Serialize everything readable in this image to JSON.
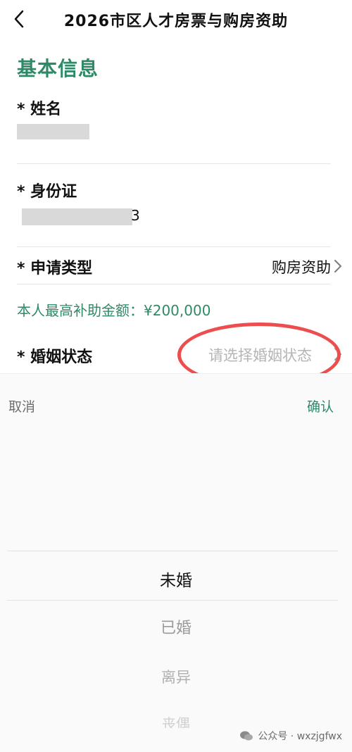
{
  "header": {
    "title": "2026市区人才房票与购房资助"
  },
  "section": {
    "title": "基本信息"
  },
  "fields": {
    "name": {
      "label": "* 姓名"
    },
    "id_card": {
      "label": "* 身份证",
      "visible_tail": "3"
    },
    "apply_type": {
      "label": "* 申请类型",
      "value": "购房资助"
    },
    "subsidy_text": "本人最高补助金额：¥200,000",
    "marital": {
      "label": "* 婚姻状态",
      "placeholder": "请选择婚姻状态"
    }
  },
  "picker": {
    "cancel": "取消",
    "confirm": "确认",
    "options": [
      "未婚",
      "已婚",
      "离异",
      "丧偶"
    ],
    "selected": "未婚"
  },
  "watermark": "公众号 · wxzjgfwx",
  "colors": {
    "accent_green": "#2e8a66",
    "highlight_circle": "#ee4d4d"
  },
  "icons": {
    "back": "chevron-left-icon",
    "row_arrow": "chevron-right-icon",
    "wechat": "wechat-icon"
  }
}
